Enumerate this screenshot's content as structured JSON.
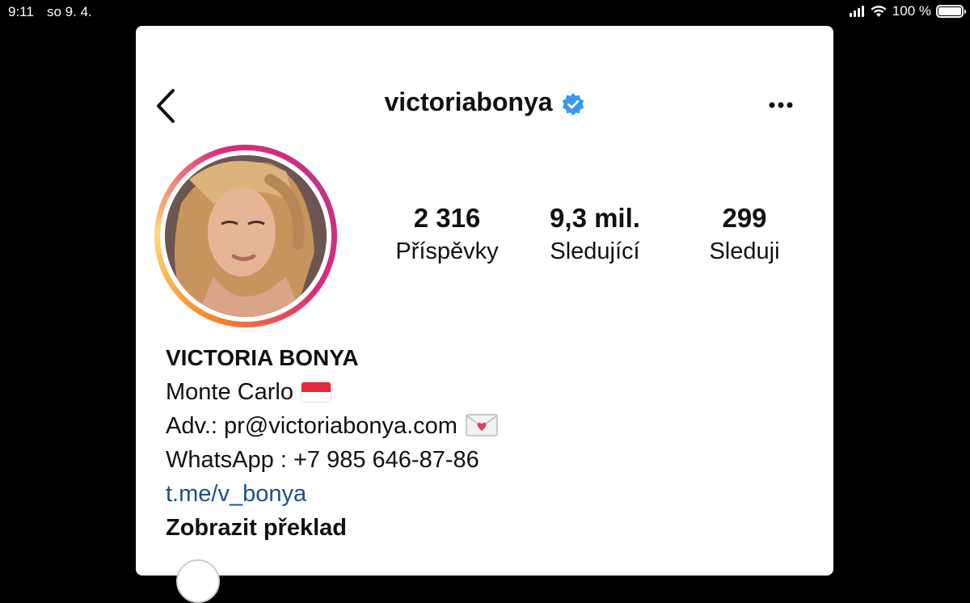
{
  "status_bar": {
    "time": "9:11",
    "date": "so 9. 4.",
    "battery_percent": "100 %",
    "battery_level": 1.0
  },
  "header": {
    "username": "victoriabonya",
    "verified": true,
    "back_icon": "chevron-left-icon",
    "more_icon": "ellipsis-icon",
    "verified_icon": "verified-badge-icon"
  },
  "stats": [
    {
      "value": "2 316",
      "label": "Příspěvky"
    },
    {
      "value": "9,3 mil.",
      "label": "Sledující"
    },
    {
      "value": "299",
      "label": "Sleduji"
    }
  ],
  "bio": {
    "name": "VICTORIA BONYA",
    "location": "Monte Carlo",
    "location_icon": "monaco-flag-icon",
    "adv": "Adv.: pr@victoriabonya.com",
    "adv_icon": "love-letter-icon",
    "whatsapp": "WhatsApp : +7 985 646-87-86",
    "link": "t.me/v_bonya",
    "translate": "Zobrazit překlad"
  },
  "colors": {
    "verified_blue": "#3897f0",
    "link_blue": "#1d4f8c",
    "story_ring": [
      "#f58529",
      "#feda77",
      "#dd2a7b",
      "#c13584"
    ]
  }
}
